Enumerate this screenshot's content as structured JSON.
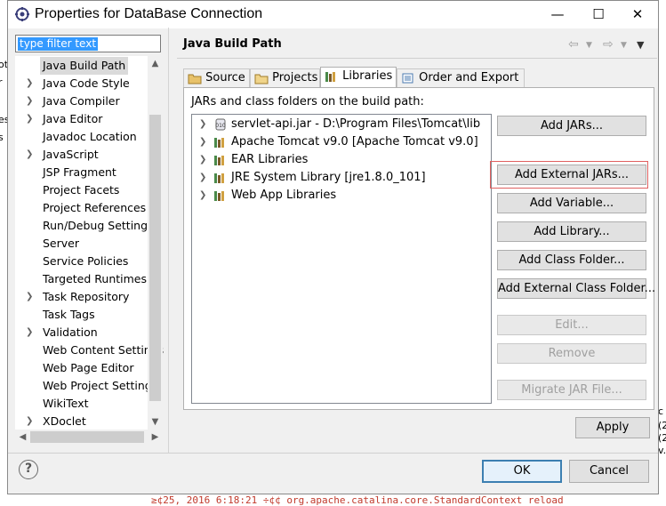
{
  "window": {
    "title": "Properties for DataBase Connection",
    "controls": {
      "minimize": "—",
      "maximize": "☐",
      "close": "✕"
    }
  },
  "filter": {
    "value": "type filter text"
  },
  "tree": {
    "items": [
      {
        "label": "Java Build Path",
        "expandable": false,
        "selected": true
      },
      {
        "label": "Java Code Style",
        "expandable": true
      },
      {
        "label": "Java Compiler",
        "expandable": true
      },
      {
        "label": "Java Editor",
        "expandable": true
      },
      {
        "label": "Javadoc Location",
        "expandable": false
      },
      {
        "label": "JavaScript",
        "expandable": true
      },
      {
        "label": "JSP Fragment",
        "expandable": false
      },
      {
        "label": "Project Facets",
        "expandable": false
      },
      {
        "label": "Project References",
        "expandable": false
      },
      {
        "label": "Run/Debug Settings",
        "expandable": false
      },
      {
        "label": "Server",
        "expandable": false
      },
      {
        "label": "Service Policies",
        "expandable": false
      },
      {
        "label": "Targeted Runtimes",
        "expandable": false
      },
      {
        "label": "Task Repository",
        "expandable": true
      },
      {
        "label": "Task Tags",
        "expandable": false
      },
      {
        "label": "Validation",
        "expandable": true
      },
      {
        "label": "Web Content Settings",
        "expandable": false
      },
      {
        "label": "Web Page Editor",
        "expandable": false
      },
      {
        "label": "Web Project Settings",
        "expandable": false
      },
      {
        "label": "WikiText",
        "expandable": false
      },
      {
        "label": "XDoclet",
        "expandable": true
      }
    ]
  },
  "page": {
    "title": "Java Build Path",
    "tabs": [
      {
        "label": "Source",
        "icon": "source-folder-icon"
      },
      {
        "label": "Projects",
        "icon": "projects-icon"
      },
      {
        "label": "Libraries",
        "icon": "libraries-icon",
        "active": true
      },
      {
        "label": "Order and Export",
        "icon": "order-export-icon"
      }
    ],
    "path_label": "JARs and class folders on the build path:",
    "libraries": [
      {
        "label": "servlet-api.jar - D:\\Program Files\\Tomcat\\lib",
        "icon": "jar-icon"
      },
      {
        "label": "Apache Tomcat v9.0 [Apache Tomcat v9.0]",
        "icon": "library-icon"
      },
      {
        "label": "EAR Libraries",
        "icon": "library-icon"
      },
      {
        "label": "JRE System Library [jre1.8.0_101]",
        "icon": "library-icon"
      },
      {
        "label": "Web App Libraries",
        "icon": "library-icon"
      }
    ],
    "buttons": {
      "add_jars": "Add JARs...",
      "add_external_jars": "Add External JARs...",
      "add_variable": "Add Variable...",
      "add_library": "Add Library...",
      "add_class_folder": "Add Class Folder...",
      "add_external_class_folder": "Add External Class Folder...",
      "edit": "Edit...",
      "remove": "Remove",
      "migrate_jar": "Migrate JAR File..."
    },
    "apply": "Apply"
  },
  "footer": {
    "help": "?",
    "ok": "OK",
    "cancel": "Cancel"
  },
  "background": {
    "left_fragments": [
      "ot",
      "r",
      "es",
      "s"
    ],
    "right_fragments": [
      "c",
      "(2",
      "(2",
      "v."
    ],
    "console_line": "≥¢25, 2016 6:18:21 ÷¢¢ org.apache.catalina.core.StandardContext reload"
  },
  "colors": {
    "highlight_border": "#e06060",
    "selection": "#3399ff"
  }
}
